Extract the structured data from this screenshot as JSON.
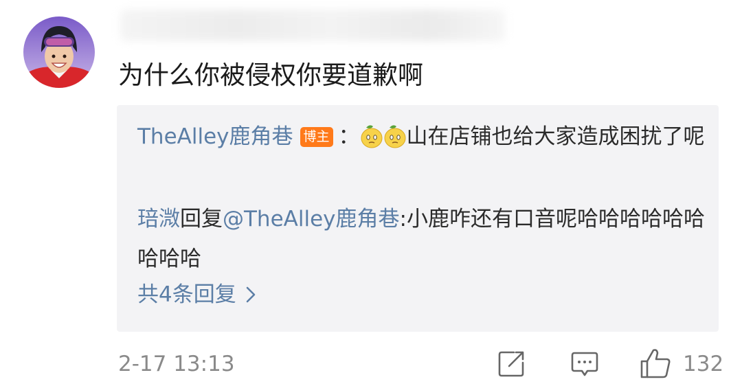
{
  "comment": {
    "text": "为什么你被侵权你要道歉啊",
    "time": "2-17 13:13",
    "like_count": "132"
  },
  "replies": [
    {
      "user": "TheAlley鹿角巷",
      "badge": "博主",
      "separator": "：",
      "emojis": [
        "melting-face-emoji",
        "melting-face-emoji"
      ],
      "text": "山在店铺也给大家造成困扰了呢"
    },
    {
      "user": "琣溦",
      "reply_word": "回复",
      "mention": "@TheAlley鹿角巷",
      "text": ":小鹿咋还有口音呢哈哈哈哈哈哈哈哈哈"
    }
  ],
  "more_replies": {
    "label": "共4条回复"
  },
  "colors": {
    "link": "#5b7ea6",
    "badge": "#ff7a1a",
    "panel": "#f3f3f5",
    "meta_text": "#8a8a8a"
  },
  "icons": [
    "share-icon",
    "comment-icon",
    "thumbs-up-icon",
    "chevron-right-icon"
  ]
}
